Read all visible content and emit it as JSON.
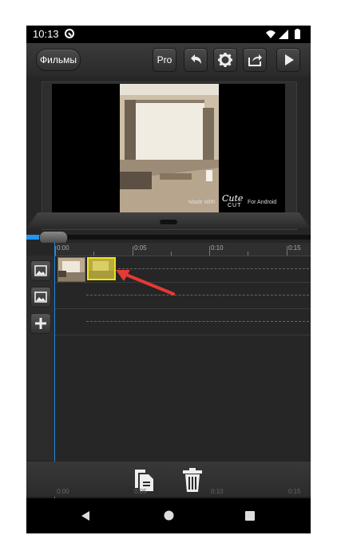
{
  "status_bar": {
    "time": "10:13"
  },
  "toolbar": {
    "movies_label": "Фильмы",
    "pro_label": "Pro"
  },
  "preview": {
    "watermark_made_with": "Made With",
    "watermark_cute": "Cute",
    "watermark_cut": "CUT",
    "watermark_for_android": "For Android"
  },
  "timeline": {
    "ruler_labels": [
      "0:00",
      "0:05",
      "0:10",
      "0:15"
    ],
    "mini_ruler_labels": [
      "0:00",
      "0:05",
      "0:10",
      "0:15"
    ],
    "playhead_color": "#1e88e5",
    "selected_clip_color": "#f0e11e",
    "arrow_color": "#e53935"
  },
  "icons": {
    "toolbar": [
      "undo-icon",
      "settings-icon",
      "share-icon",
      "play-icon"
    ],
    "side": [
      "image-track-icon",
      "image-track-icon",
      "add-track-icon"
    ],
    "bottom": [
      "copy-icon",
      "delete-icon"
    ],
    "nav": [
      "back-icon",
      "home-icon",
      "recents-icon"
    ]
  }
}
